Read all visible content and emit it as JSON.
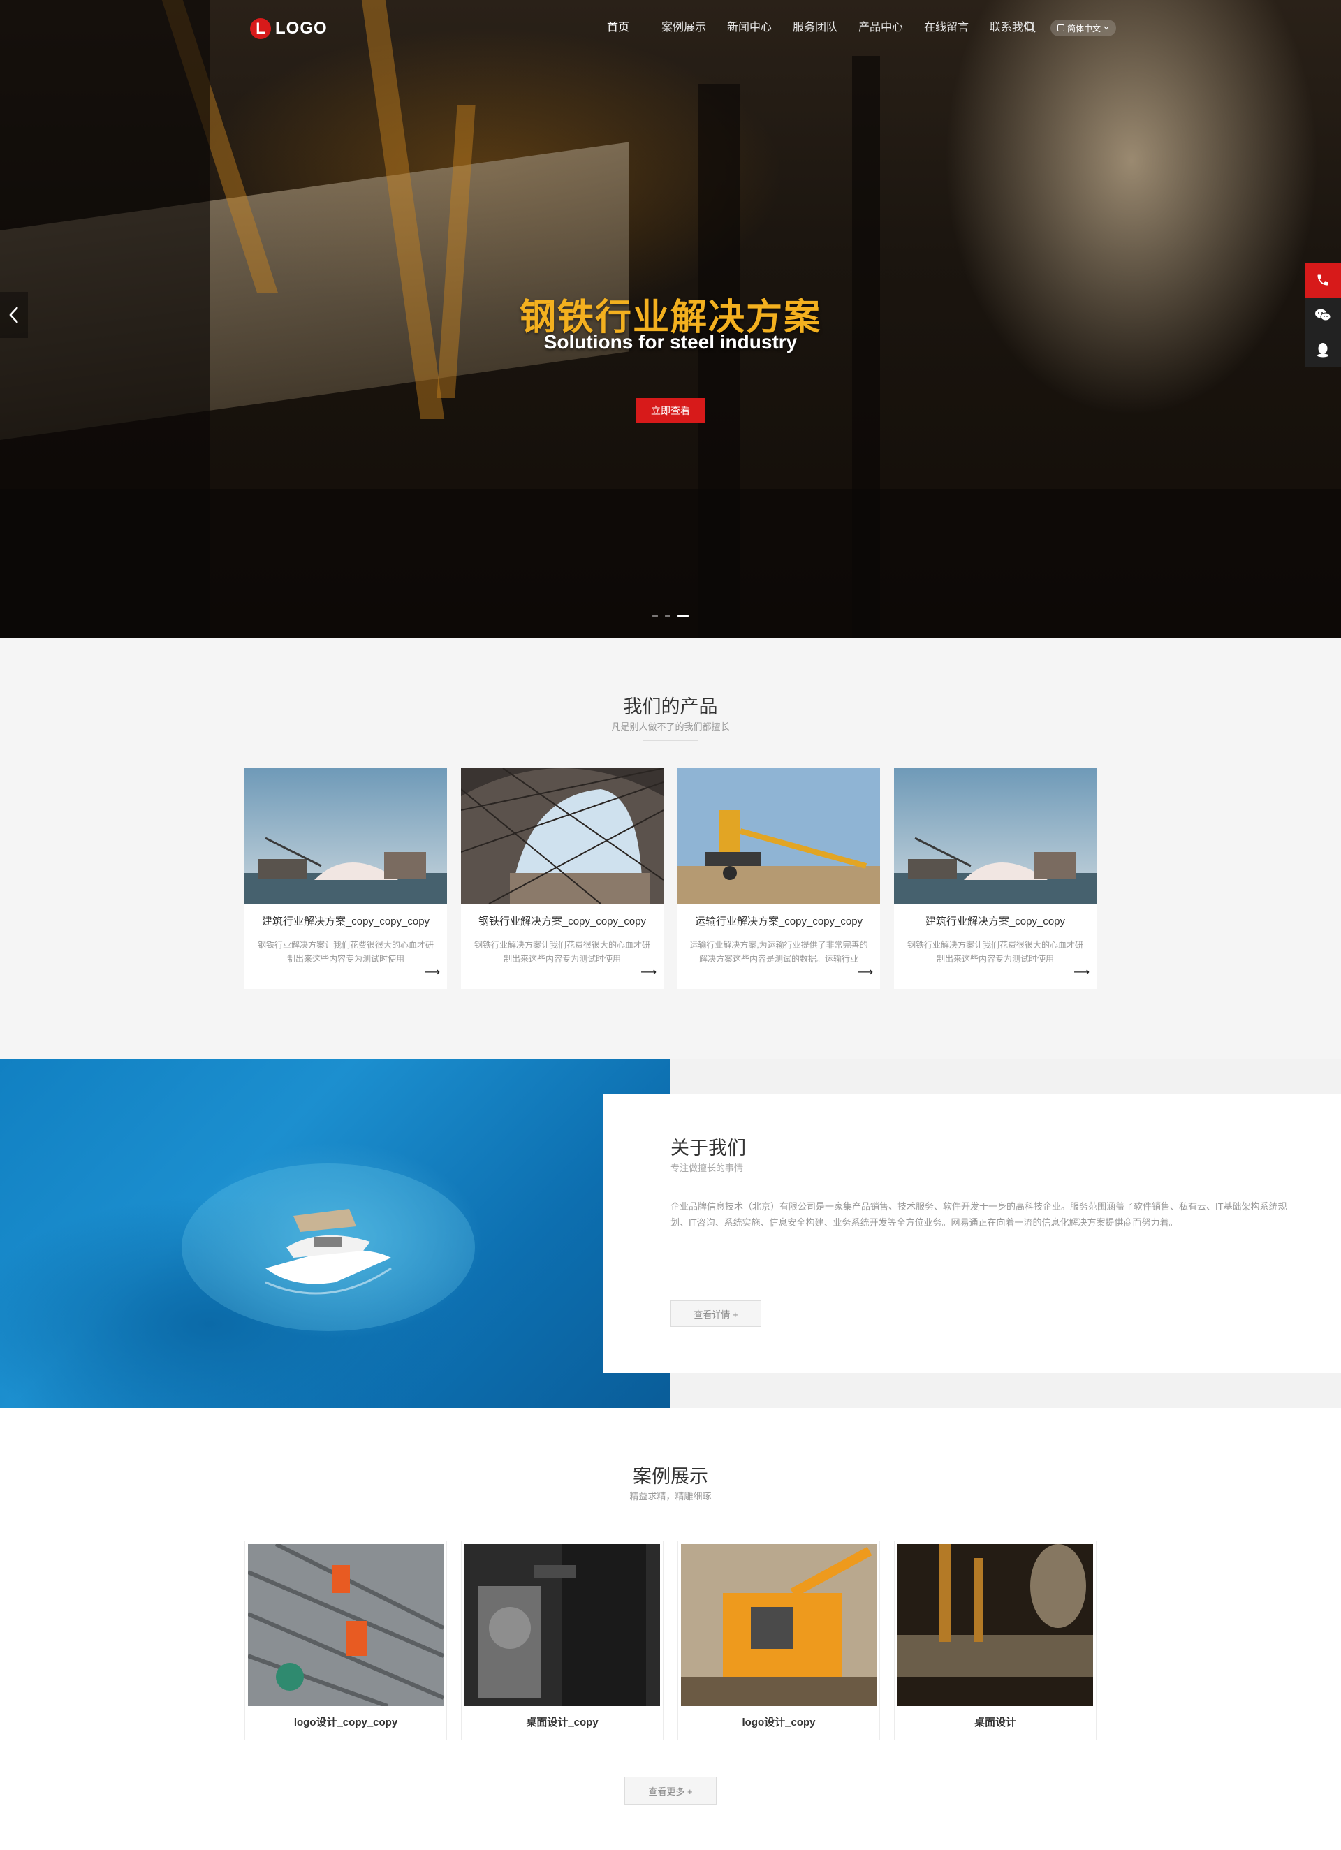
{
  "header": {
    "logo_mark": "L",
    "logo_text": "LOGO",
    "nav": [
      "首页",
      "案例展示",
      "新闻中心",
      "服务团队",
      "产品中心",
      "在线留言",
      "联系我们"
    ],
    "lang": "简体中文"
  },
  "hero": {
    "title": "钢铁行业解决方案",
    "subtitle": "Solutions for steel industry",
    "button": "立即查看",
    "slides_total": 3,
    "active_slide": 3
  },
  "colors": {
    "accent": "#d71a1a",
    "hero_title": "#f3b01f"
  },
  "products": {
    "title": "我们的产品",
    "subtitle": "凡是别人做不了的我们都擅长",
    "items": [
      {
        "name": "建筑行业解决方案_copy_copy_copy",
        "desc": "钢铁行业解决方案让我们花费很很大的心血才研制出来这些内容专为测试时使用"
      },
      {
        "name": "钢铁行业解决方案_copy_copy_copy",
        "desc": "钢铁行业解决方案让我们花费很很大的心血才研制出来这些内容专为测试时使用"
      },
      {
        "name": "运输行业解决方案_copy_copy_copy",
        "desc": "运输行业解决方案,为运输行业提供了非常完善的解决方案这些内容是测试的数据。运输行业"
      },
      {
        "name": "建筑行业解决方案_copy_copy",
        "desc": "钢铁行业解决方案让我们花费很很大的心血才研制出来这些内容专为测试时使用"
      }
    ]
  },
  "about": {
    "title": "关于我们",
    "subtitle": "专注做擅长的事情",
    "text": "企业品牌信息技术（北京）有限公司是一家集产品销售、技术服务、软件开发于一身的高科技企业。服务范围涵盖了软件销售、私有云、IT基础架构系统规划、IT咨询、系统实施、信息安全构建、业务系统开发等全方位业务。网易通正在向着一流的信息化解决方案提供商而努力着。",
    "button": "查看详情 +"
  },
  "cases": {
    "title": "案例展示",
    "subtitle": "精益求精，精雕细琢",
    "items": [
      "logo设计_copy_copy",
      "桌面设计_copy",
      "logo设计_copy",
      "桌面设计"
    ],
    "more": "查看更多 +"
  },
  "side": {
    "icons": [
      "phone-icon",
      "wechat-icon",
      "qq-icon"
    ]
  }
}
